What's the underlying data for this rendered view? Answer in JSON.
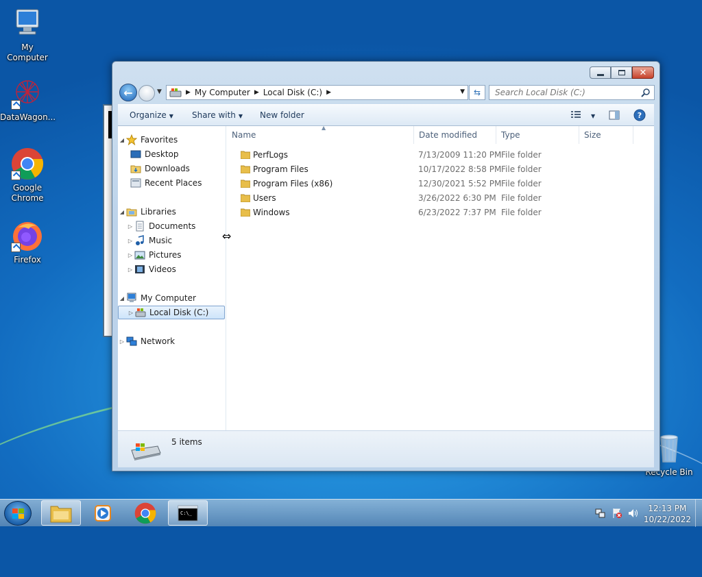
{
  "desktop": {
    "icons": [
      {
        "label": "My Computer",
        "icon": "computer-icon"
      },
      {
        "label": "DataWagon...",
        "icon": "datawagon-icon"
      },
      {
        "label": "Google Chrome",
        "icon": "chrome-icon"
      },
      {
        "label": "Firefox",
        "icon": "firefox-icon"
      },
      {
        "label": "Recycle Bin",
        "icon": "recycle-bin-icon"
      }
    ]
  },
  "explorer": {
    "address": {
      "crumbs": [
        "My Computer",
        "Local Disk (C:)"
      ]
    },
    "search": {
      "placeholder": "Search Local Disk (C:)"
    },
    "toolbar": {
      "organize": "Organize",
      "share_with": "Share with",
      "new_folder": "New folder"
    },
    "nav": {
      "favorites": "Favorites",
      "desktop": "Desktop",
      "downloads": "Downloads",
      "recent_places": "Recent Places",
      "libraries": "Libraries",
      "documents": "Documents",
      "music": "Music",
      "pictures": "Pictures",
      "videos": "Videos",
      "my_computer": "My Computer",
      "local_disk": "Local Disk (C:)",
      "network": "Network"
    },
    "columns": {
      "name": "Name",
      "date_modified": "Date modified",
      "type": "Type",
      "size": "Size"
    },
    "rows": [
      {
        "name": "PerfLogs",
        "date": "7/13/2009 11:20 PM",
        "type": "File folder"
      },
      {
        "name": "Program Files",
        "date": "10/17/2022 8:58 PM",
        "type": "File folder"
      },
      {
        "name": "Program Files (x86)",
        "date": "12/30/2021 5:52 PM",
        "type": "File folder"
      },
      {
        "name": "Users",
        "date": "3/26/2022 6:30 PM",
        "type": "File folder"
      },
      {
        "name": "Windows",
        "date": "6/23/2022 7:37 PM",
        "type": "File folder"
      }
    ],
    "status": {
      "item_count": "5 items"
    }
  },
  "taskbar": {
    "clock": {
      "time": "12:13 PM",
      "date": "10/22/2022"
    }
  }
}
